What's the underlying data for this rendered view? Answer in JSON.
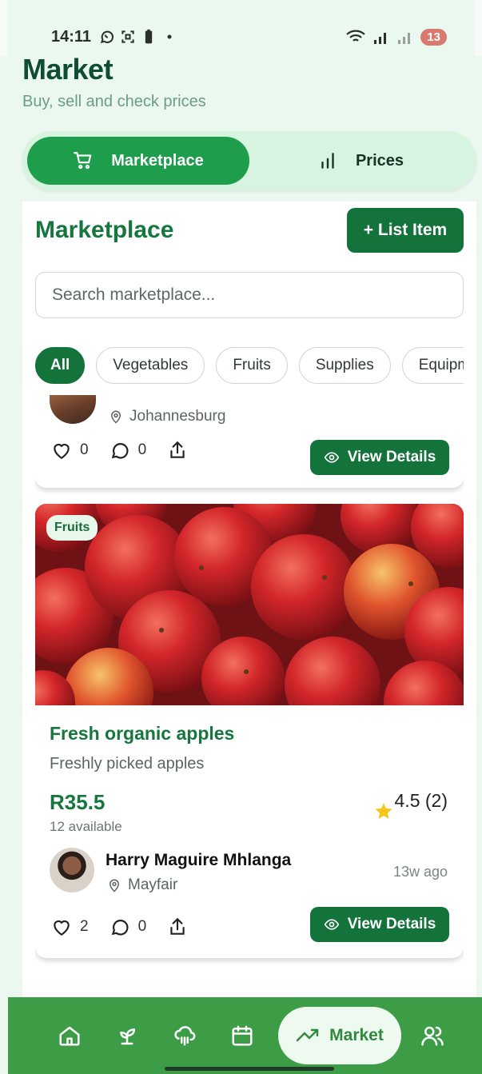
{
  "status_bar": {
    "time": "14:11",
    "battery": "13"
  },
  "header": {
    "title": "Market",
    "subtitle": "Buy, sell and check prices"
  },
  "tabs": [
    {
      "label": "Marketplace",
      "icon": "cart-icon",
      "active": true
    },
    {
      "label": "Prices",
      "icon": "bar-chart-icon",
      "active": false
    }
  ],
  "panel": {
    "title": "Marketplace",
    "list_item_label": "+ List Item",
    "search_placeholder": "Search marketplace...",
    "chips": [
      "All",
      "Vegetables",
      "Fruits",
      "Supplies",
      "Equipm"
    ]
  },
  "listings": [
    {
      "location": "Johannesburg",
      "likes": "0",
      "comments": "0",
      "view_label": "View Details"
    },
    {
      "category": "Fruits",
      "title": "Fresh organic apples",
      "description": "Freshly picked apples",
      "price": "R35.5",
      "available": "12 available",
      "rating": "4.5 (2)",
      "seller": "Harry Maguire Mhlanga",
      "location": "Mayfair",
      "posted": "13w ago",
      "likes": "2",
      "comments": "0",
      "view_label": "View Details"
    }
  ],
  "bottom_nav": {
    "items": [
      "home-icon",
      "sprout-icon",
      "cloud-rain-icon",
      "calendar-icon",
      "market-trend-icon",
      "users-icon"
    ],
    "active_label": "Market"
  },
  "colors": {
    "primary": "#14733a",
    "accent": "#1e9d4c",
    "nav_bg": "#3d9d47",
    "background": "#ebf8f0"
  }
}
